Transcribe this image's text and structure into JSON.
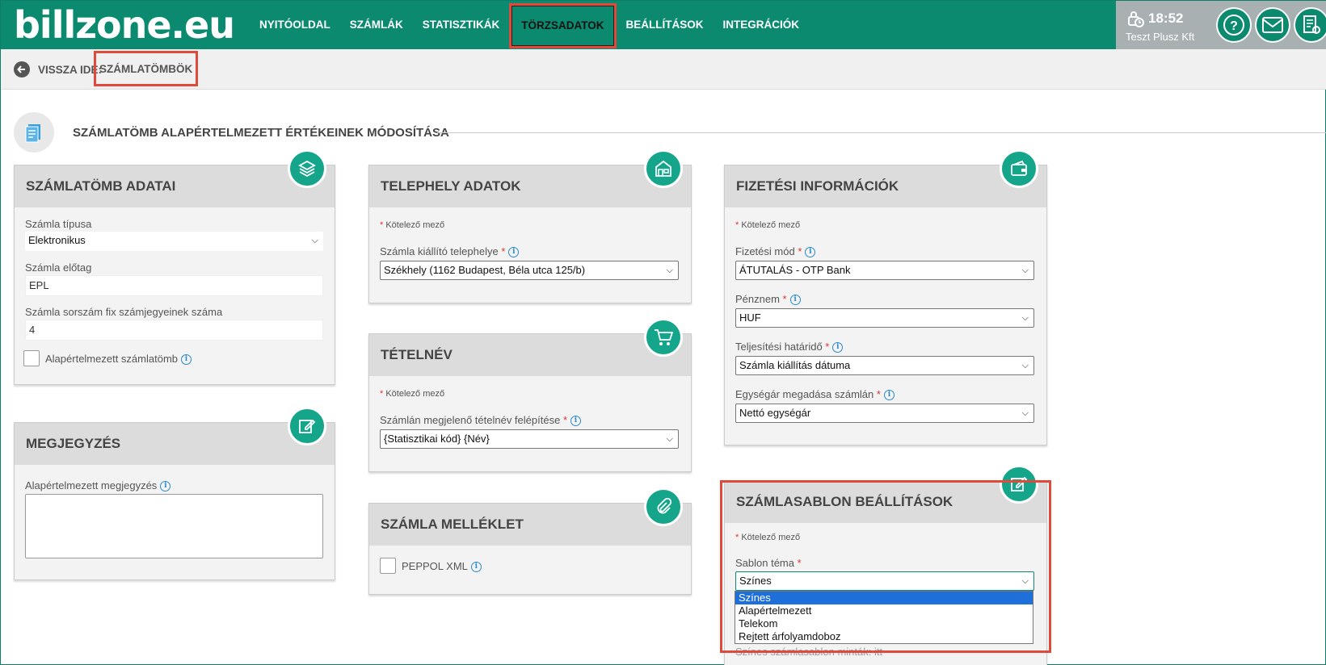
{
  "header": {
    "logo": "billzone.eu",
    "nav": [
      "NYITÓOLDAL",
      "SZÁMLÁK",
      "STATISZTIKÁK",
      "TÖRZSADATOK",
      "BEÁLLÍTÁSOK",
      "INTEGRÁCIÓK"
    ],
    "active_nav": "TÖRZSADATOK",
    "time": "18:52",
    "company": "Teszt Plusz Kft"
  },
  "breadcrumb": {
    "back_label": "VISSZA IDE:",
    "current": "SZÁMLATÖMBÖK"
  },
  "page": {
    "title": "SZÁMLATÖMB ALAPÉRTELMEZETT ÉRTÉKEINEK MÓDOSÍTÁSA"
  },
  "required_note": "Kötelező mező",
  "szamlatomb": {
    "title": "SZÁMLATÖMB ADATAI",
    "type_label": "Számla típusa",
    "type_value": "Elektronikus",
    "prefix_label": "Számla előtag",
    "prefix_value": "EPL",
    "digits_label": "Számla sorszám fix számjegyeinek száma",
    "digits_value": "4",
    "default_label": "Alapértelmezett számlatömb"
  },
  "megjegyzes": {
    "title": "MEGJEGYZÉS",
    "label": "Alapértelmezett megjegyzés"
  },
  "telephely": {
    "title": "TELEPHELY ADATOK",
    "label": "Számla kiállító telephelye",
    "value": "Székhely (1162 Budapest, Béla utca 125/b)"
  },
  "tetelnev": {
    "title": "TÉTELNÉV",
    "label": "Számlán megjelenő tételnév felépítése",
    "value": "{Statisztikai kód} {Név}"
  },
  "melleklet": {
    "title": "SZÁMLA MELLÉKLET",
    "peppol_label": "PEPPOL XML"
  },
  "fizetes": {
    "title": "FIZETÉSI INFORMÁCIÓK",
    "mode_label": "Fizetési mód",
    "mode_value": "ÁTUTALÁS - OTP Bank",
    "currency_label": "Pénznem",
    "currency_value": "HUF",
    "deadline_label": "Teljesítési határidő",
    "deadline_value": "Számla kiállítás dátuma",
    "unitprice_label": "Egységár megadása számlán",
    "unitprice_value": "Nettó egységár"
  },
  "sablon": {
    "title": "SZÁMLASABLON BEÁLLÍTÁSOK",
    "theme_label": "Sablon téma",
    "theme_value": "Színes",
    "options": [
      "Színes",
      "Alapértelmezett",
      "Telekom",
      "Rejtett árfolyamdoboz"
    ],
    "footer_partial": "Színes számlasablon minták: itt"
  },
  "colors": {
    "brand": "#0b8a70",
    "accent_icon": "#14a58a",
    "highlight": "#e04a3c",
    "select_blue": "#1e6fd9"
  },
  "icons": [
    "lock-clock-icon",
    "help-icon",
    "mail-icon",
    "document-settings-icon",
    "back-arrow-icon",
    "invoice-block-icon",
    "layers-icon",
    "store-icon",
    "wallet-icon",
    "cart-icon",
    "edit-note-icon",
    "paperclip-icon",
    "template-edit-icon"
  ]
}
